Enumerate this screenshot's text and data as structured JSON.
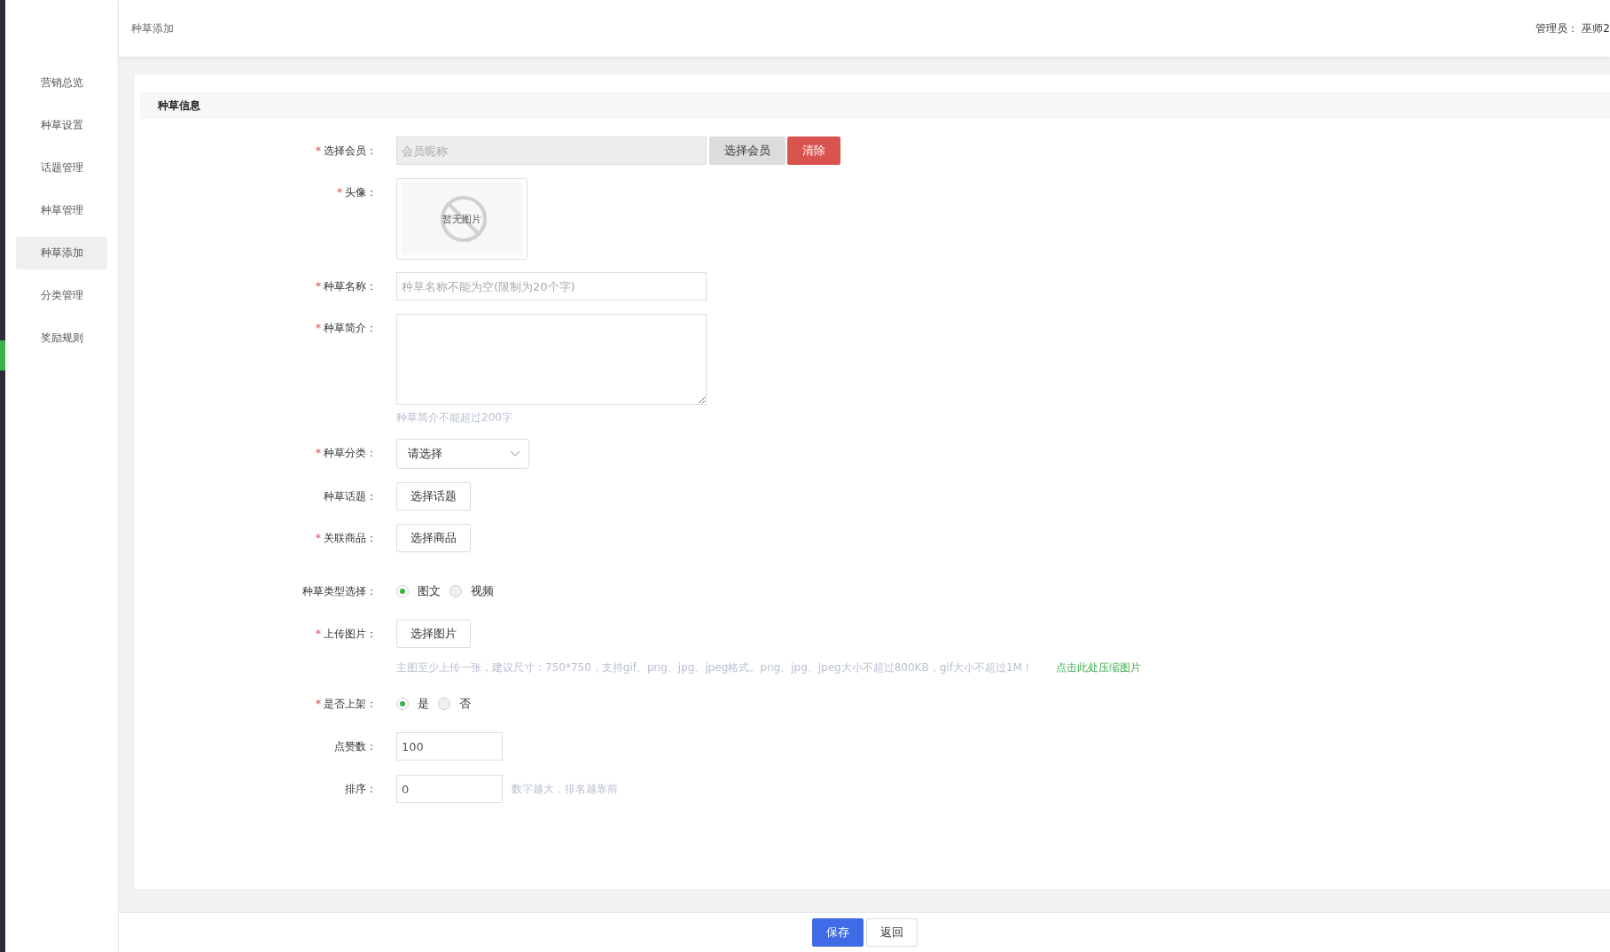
{
  "sidebar": {
    "items": [
      {
        "label": "营销总览",
        "selected": false
      },
      {
        "label": "种草设置",
        "selected": false
      },
      {
        "label": "话题管理",
        "selected": false
      },
      {
        "label": "种草管理",
        "selected": false
      },
      {
        "label": "种草添加",
        "selected": true
      },
      {
        "label": "分类管理",
        "selected": false
      },
      {
        "label": "奖励规则",
        "selected": false
      }
    ]
  },
  "header": {
    "breadcrumb": "种草添加",
    "admin_label": "管理员：",
    "admin_name": "巫师2"
  },
  "section_title": "种草信息",
  "fields": [
    {
      "kind": "member",
      "label": "选择会员：",
      "required_mark": "*",
      "placeholder": "会员昵称",
      "buttons": [
        "选择会员",
        "清除"
      ]
    },
    {
      "kind": "image",
      "label": "头像：",
      "required_mark": "*",
      "image_text": "暂无图片"
    },
    {
      "kind": "text",
      "label": "种草名称：",
      "required_mark": "*",
      "placeholder": "种草名称不能为空(限制为20个字)"
    },
    {
      "kind": "textarea",
      "label": "种草简介：",
      "required_mark": "*",
      "hint": "种草简介不能超过200字"
    },
    {
      "kind": "select",
      "label": "种草分类：",
      "required_mark": "*",
      "value": "请选择"
    },
    {
      "kind": "button",
      "label": "种草话题：",
      "button": "选择话题"
    },
    {
      "kind": "button",
      "label": "关联商品：",
      "required_mark": "*",
      "button": "选择商品"
    },
    {
      "kind": "radio",
      "label": "种草类型选择：",
      "options": [
        {
          "label": "图文",
          "selected": true
        },
        {
          "label": "视频",
          "selected": false
        }
      ]
    },
    {
      "kind": "upload",
      "label": "上传图片：",
      "required_mark": "*",
      "button": "选择图片",
      "hint": "主图至少上传一张，建议尺寸：750*750，支持gif、png、jpg、jpeg格式。png、jpg、jpeg大小不超过800KB，gif大小不超过1M！",
      "link": "点击此处压缩图片"
    },
    {
      "kind": "radio",
      "label": "是否上架：",
      "required_mark": "*",
      "options": [
        {
          "label": "是",
          "selected": true
        },
        {
          "label": "否",
          "selected": false
        }
      ]
    },
    {
      "kind": "number",
      "label": "点赞数：",
      "value": "100"
    },
    {
      "kind": "number",
      "label": "排序：",
      "value": "0",
      "hint": "数字越大，排名越靠前"
    }
  ],
  "footer": {
    "buttons": [
      {
        "kind": "primary",
        "label": "保存"
      },
      {
        "kind": "default",
        "label": "返回"
      }
    ]
  }
}
